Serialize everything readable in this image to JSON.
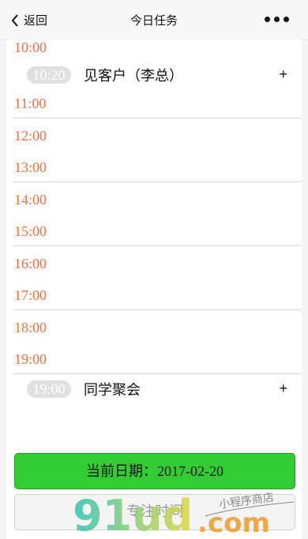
{
  "nav": {
    "back_label": "返回",
    "title": "今日任务"
  },
  "timeline": {
    "hours": [
      "10:00",
      "11:00",
      "12:00",
      "13:00",
      "14:00",
      "15:00",
      "16:00",
      "17:00",
      "18:00",
      "19:00"
    ]
  },
  "tasks": [
    {
      "time": "10:20",
      "name": "见客户（李总）",
      "add": "+"
    },
    {
      "time": "19:00",
      "name": "同学聚会",
      "add": "+"
    }
  ],
  "buttons": {
    "date_label": "当前日期：2017-02-20",
    "focus_label": "专注时间"
  },
  "watermark": {
    "brand": "91ud.com",
    "tagline": "小程序商店"
  },
  "colors": {
    "hour": "#ff6b3d",
    "date_button": "#32cd32"
  }
}
